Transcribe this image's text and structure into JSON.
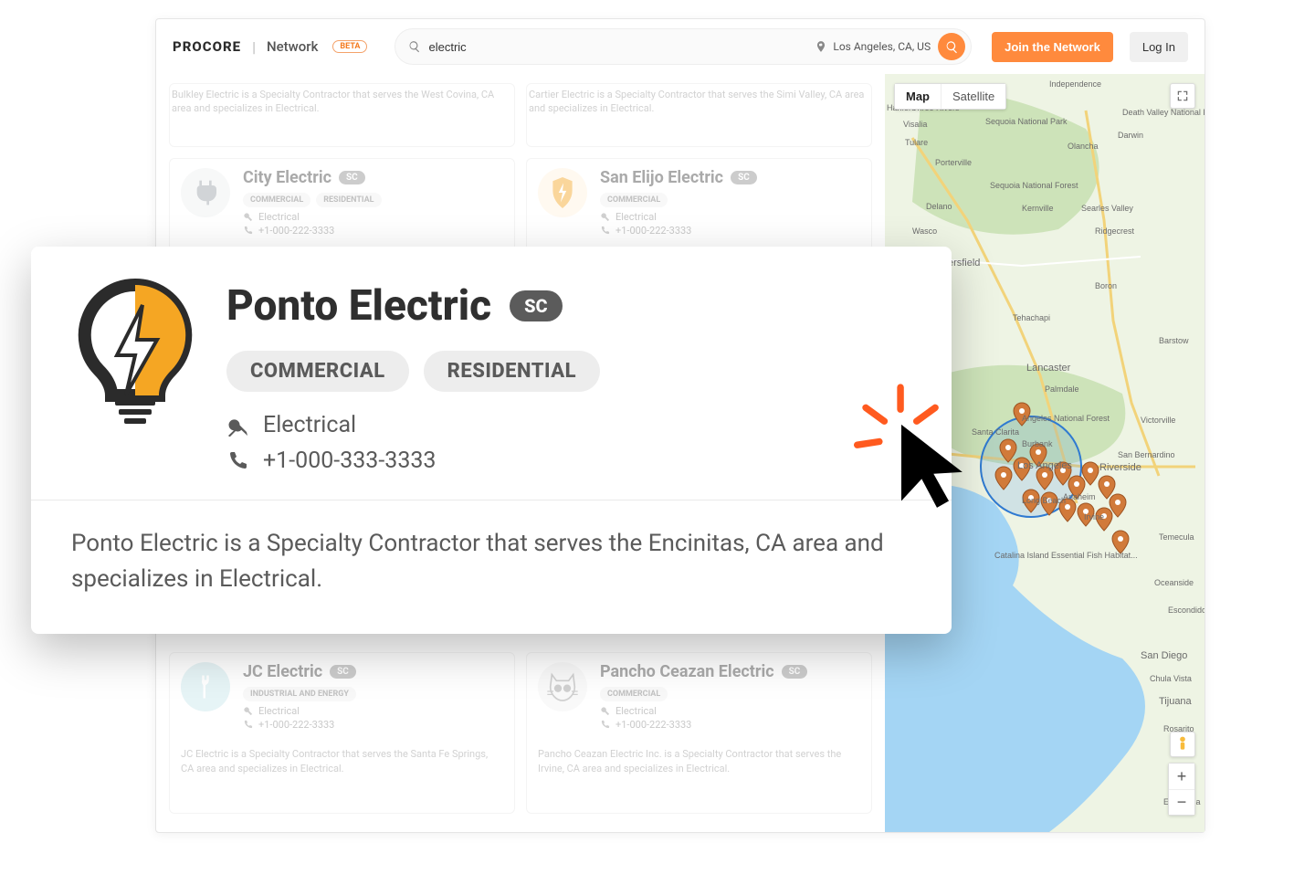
{
  "header": {
    "logo_text": "PROCORE",
    "network_label": "Network",
    "beta_label": "BETA",
    "search_value": "electric",
    "location_text": "Los Angeles, CA, US",
    "join_label": "Join the Network",
    "login_label": "Log In"
  },
  "map": {
    "map_btn": "Map",
    "sat_btn": "Satellite",
    "zoom_in": "+",
    "zoom_out": "−",
    "labels": {
      "independence": "Independence",
      "three_rivers": "Three Rivers",
      "sequoia_np": "Sequoia National Park",
      "death_valley_np": "Death Valley National Park",
      "darwin": "Darwin",
      "olancha": "Olancha",
      "visalia": "Visalia",
      "hanford": "Hanford",
      "tulare": "Tulare",
      "porterville": "Porterville",
      "sequoia_nf": "Sequoia National Forest",
      "kernville": "Kernville",
      "searles_valley": "Searles Valley",
      "ridgecrest": "Ridgecrest",
      "delano": "Delano",
      "wasco": "Wasco",
      "bakersfield": "Bakersfield",
      "boron": "Boron",
      "tehachapi": "Tehachapi",
      "barstow": "Barstow",
      "lancaster": "Lancaster",
      "palmdale": "Palmdale",
      "victorville": "Victorville",
      "angeles_nf": "Angeles National Forest",
      "santa_clarita": "Santa Clarita",
      "burbank": "Burbank",
      "los_angeles": "Los Angeles",
      "anaheim": "Anaheim",
      "long_beach": "Long Beach",
      "irvine": "Irvine",
      "riverside": "Riverside",
      "san_bernardino": "San Bernardino",
      "temecula": "Temecula",
      "catalina": "Catalina Island Essential Fish Habitat...",
      "oceanside": "Oceanside",
      "escondido": "Escondido",
      "san_diego": "San Diego",
      "chula_vista": "Chula Vista",
      "tijuana": "Tijuana",
      "ensenada": "Ensenada",
      "rosarito": "Rosarito"
    }
  },
  "results": [
    {
      "desc_only": true,
      "desc": "Bulkley Electric is a Specialty Contractor that serves the West Covina, CA area and specializes in Electrical."
    },
    {
      "desc_only": true,
      "desc": "Cartier Electric is a Specialty Contractor that serves the Simi Valley, CA area and specializes in Electrical."
    },
    {
      "name": "City Electric",
      "badge": "SC",
      "tags": [
        "COMMERCIAL",
        "RESIDENTIAL"
      ],
      "trade": "Electrical",
      "phone": "+1-000-222-3333",
      "icon": "plug"
    },
    {
      "name": "San Elijo Electric",
      "badge": "SC",
      "tags": [
        "COMMERCIAL"
      ],
      "trade": "Electrical",
      "phone": "+1-000-222-3333",
      "icon": "bolt-shield"
    },
    {
      "name": "JC Electric",
      "badge": "SC",
      "tags": [
        "INDUSTRIAL AND ENERGY"
      ],
      "trade": "Electrical",
      "phone": "+1-000-222-3333",
      "desc": "JC Electric is a Specialty Contractor that serves the Santa Fe Springs, CA area and specializes in Electrical.",
      "icon": "plug-teal"
    },
    {
      "name": "Pancho Ceazan Electric",
      "badge": "SC",
      "tags": [
        "COMMERCIAL"
      ],
      "trade": "Electrical",
      "phone": "+1-000-222-3333",
      "desc": "Pancho Ceazan Electric Inc. is a Specialty Contractor that serves the Irvine, CA area and specializes in Electrical.",
      "icon": "cat"
    }
  ],
  "popover": {
    "name": "Ponto Electric",
    "badge": "SC",
    "tags": [
      "COMMERCIAL",
      "RESIDENTIAL"
    ],
    "trade": "Electrical",
    "phone": "+1-000-333-3333",
    "desc": "Ponto Electric is a Specialty Contractor that serves the Encinitas, CA area and specializes in Electrical."
  }
}
